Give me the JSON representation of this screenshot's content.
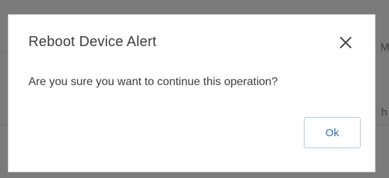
{
  "dialog": {
    "title": "Reboot Device Alert",
    "message": "Are you sure you want to continue this operation?",
    "ok_label": "Ok",
    "close_icon": "close-icon"
  },
  "background": {
    "fragment_top": "M",
    "fragment_mid": "h"
  }
}
